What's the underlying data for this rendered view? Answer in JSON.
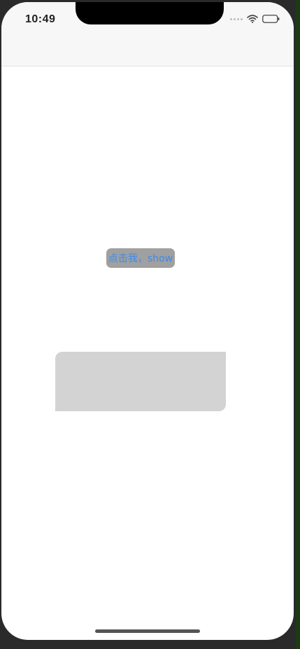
{
  "status_bar": {
    "time": "10:49",
    "icons": [
      "signal-icon",
      "wifi-icon",
      "battery-icon"
    ]
  },
  "main": {
    "show_button_label": "点击我，show"
  },
  "colors": {
    "button_background": "#a0a0a0",
    "button_text": "#3b8bec",
    "panel_background": "#d3d3d3",
    "status_bar_background": "#f7f7f7"
  }
}
